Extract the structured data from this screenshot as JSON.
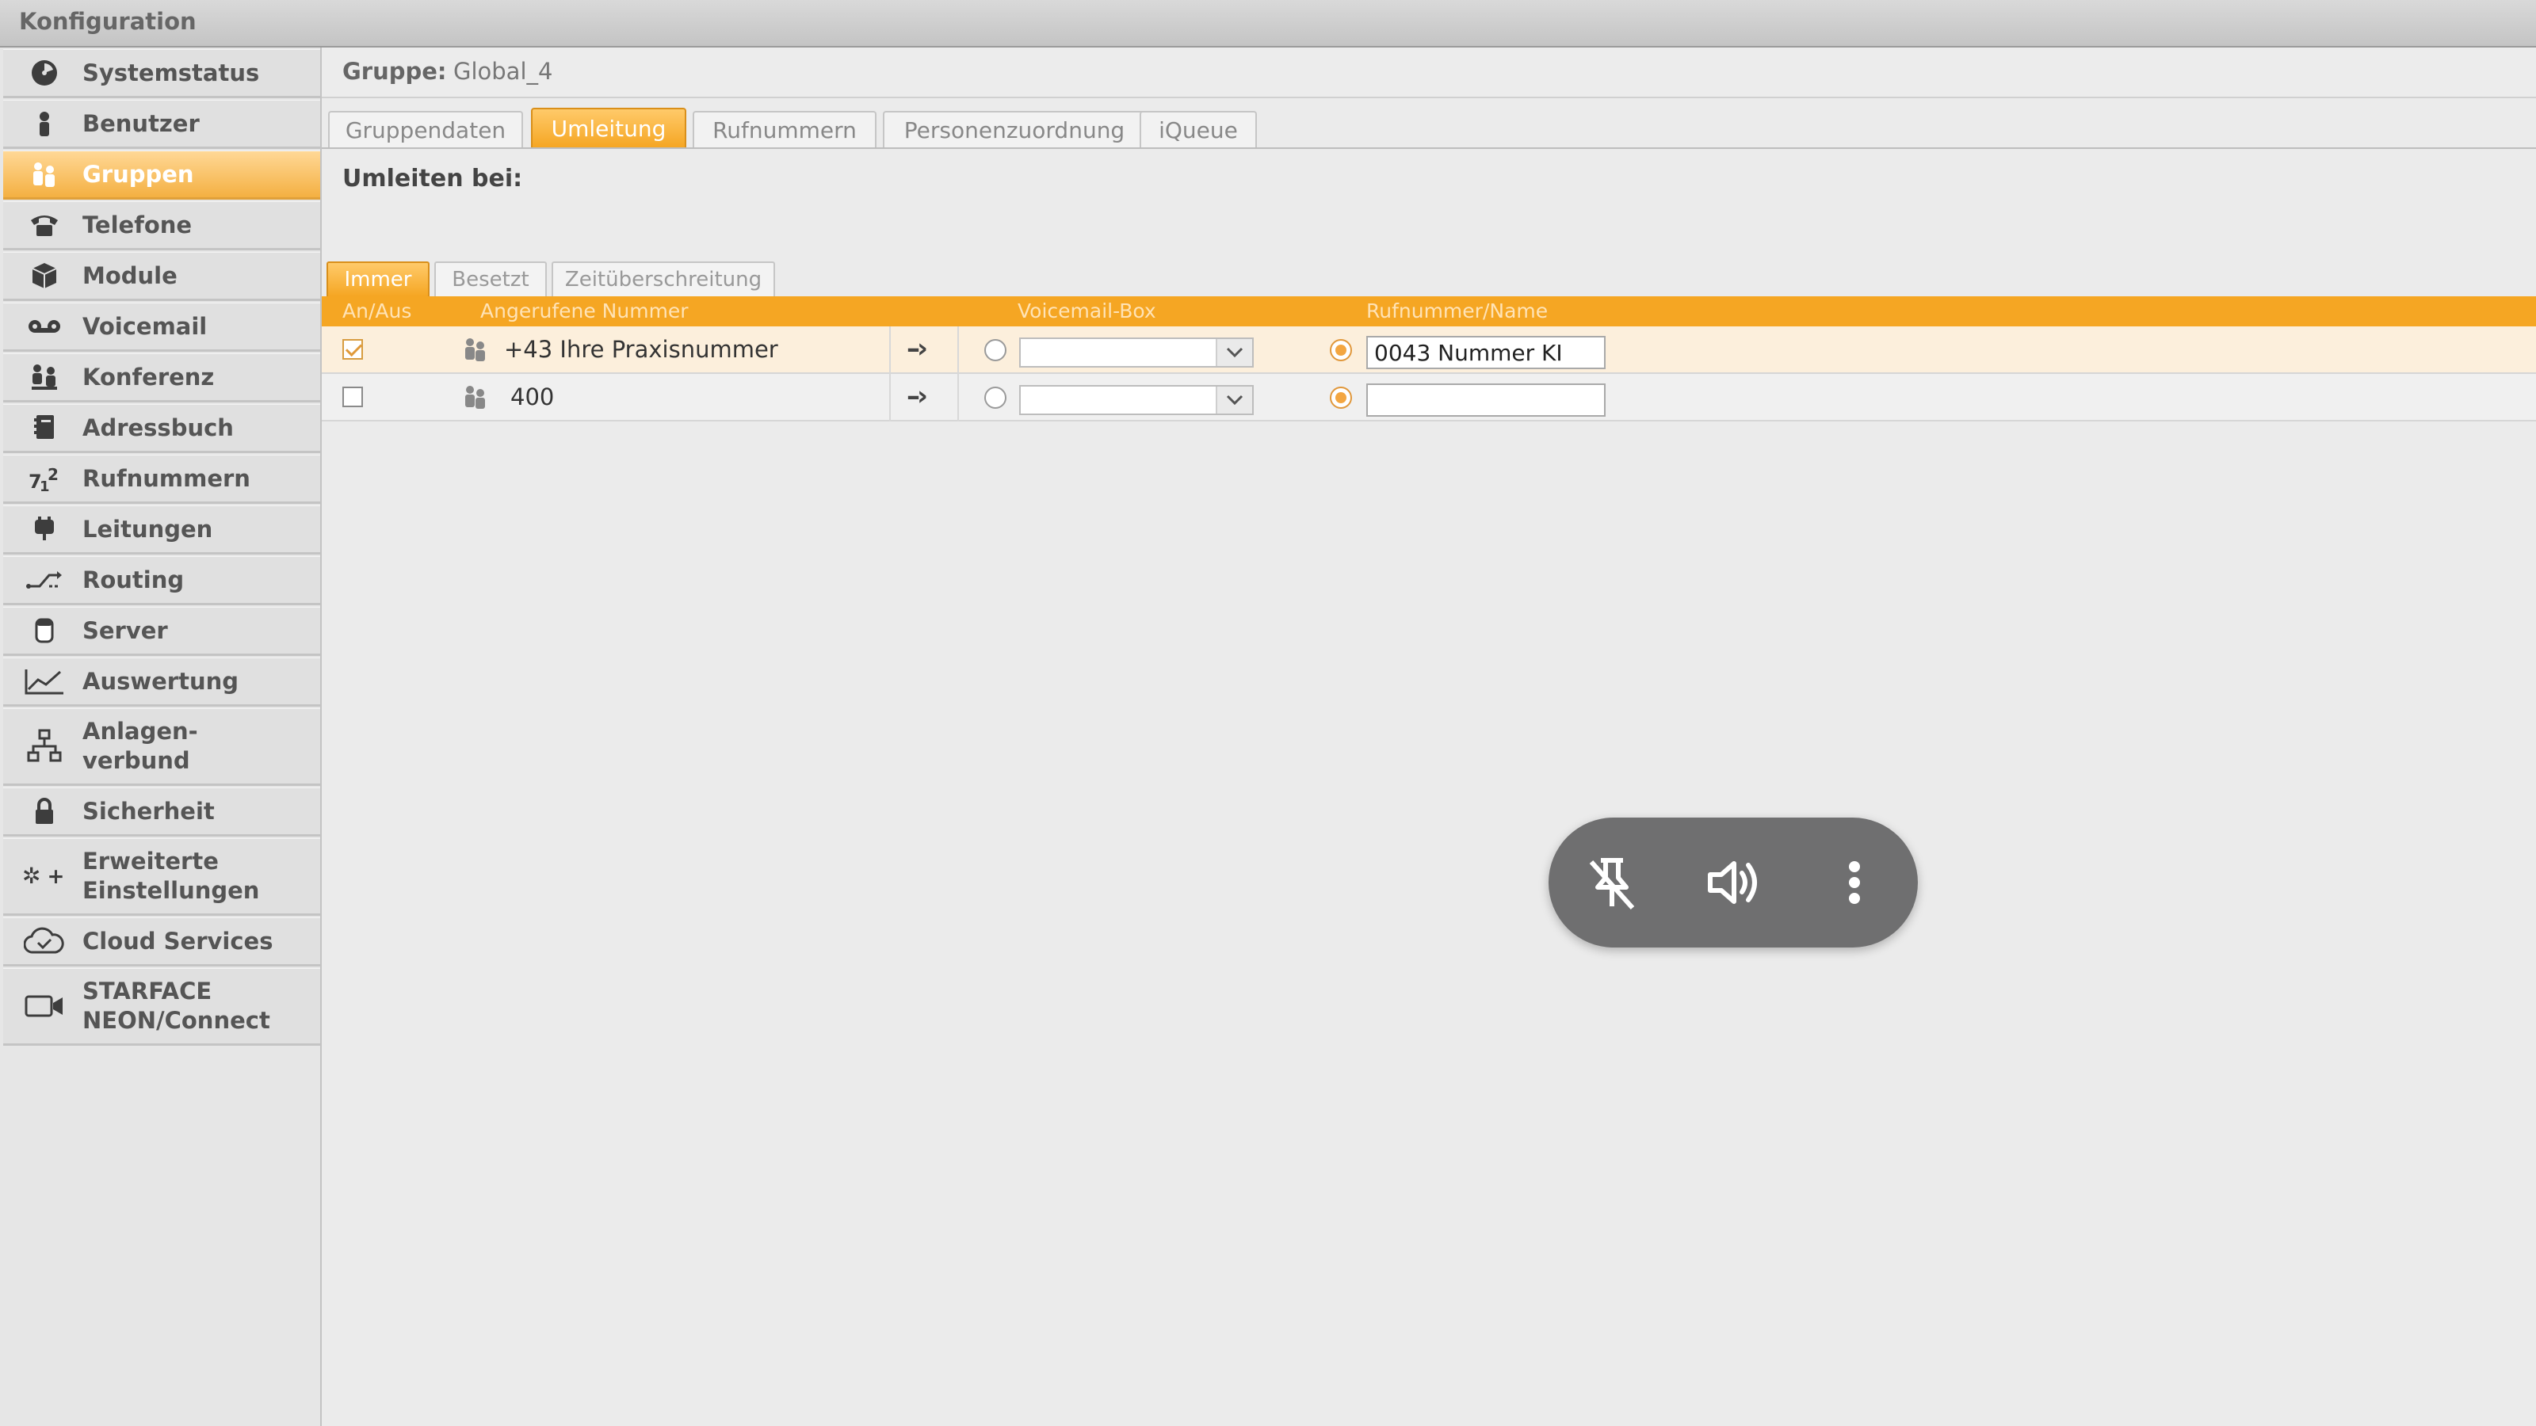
{
  "window": {
    "title": "Konfiguration"
  },
  "sidebar": {
    "items": [
      {
        "label": "Systemstatus",
        "icon": "dashboard-icon"
      },
      {
        "label": "Benutzer",
        "icon": "user-icon"
      },
      {
        "label": "Gruppen",
        "icon": "group-icon",
        "active": true
      },
      {
        "label": "Telefone",
        "icon": "phone-icon"
      },
      {
        "label": "Module",
        "icon": "module-cube-icon"
      },
      {
        "label": "Voicemail",
        "icon": "voicemail-icon"
      },
      {
        "label": "Konferenz",
        "icon": "conference-icon"
      },
      {
        "label": "Adressbuch",
        "icon": "address-book-icon"
      },
      {
        "label": "Rufnummern",
        "icon": "numbers-icon"
      },
      {
        "label": "Leitungen",
        "icon": "line-plug-icon"
      },
      {
        "label": "Routing",
        "icon": "routing-icon"
      },
      {
        "label": "Server",
        "icon": "server-icon"
      },
      {
        "label": "Auswertung",
        "icon": "chart-icon"
      },
      {
        "label": "Anlagen-\nverbund",
        "icon": "network-icon"
      },
      {
        "label": "Sicherheit",
        "icon": "lock-icon"
      },
      {
        "label": "Erweiterte\nEinstellungen",
        "icon": "gears-plus-icon"
      },
      {
        "label": "Cloud Services",
        "icon": "cloud-check-icon"
      },
      {
        "label": "STARFACE\nNEON/Connect",
        "icon": "video-camera-icon"
      }
    ]
  },
  "main": {
    "group_key": "Gruppe:",
    "group_value": "Global_4",
    "tabs": [
      "Gruppendaten",
      "Umleitung",
      "Rufnummern",
      "Personenzuordnung",
      "iQueue"
    ],
    "active_tab": "Umleitung",
    "section_label": "Umleiten bei:",
    "subtabs": [
      "Immer",
      "Besetzt",
      "Zeitüberschreitung"
    ],
    "active_subtab": "Immer",
    "columns": [
      "An/Aus",
      "Angerufene Nummer",
      "Voicemail-Box",
      "Rufnummer/Name"
    ],
    "rows": [
      {
        "enabled": true,
        "number": "+43 Ihre Praxisnummer",
        "arrow": "–›",
        "voicemail_selected": false,
        "voicemail_value": "",
        "target_selected": true,
        "target_value": "0043 Nummer KI"
      },
      {
        "enabled": false,
        "number": "400",
        "arrow": "–›",
        "voicemail_selected": false,
        "voicemail_value": "",
        "target_selected": true,
        "target_value": ""
      }
    ]
  },
  "media_overlay": {
    "buttons": [
      "unpin-icon",
      "volume-icon",
      "more-vertical-icon"
    ]
  },
  "colors": {
    "accent": "#f5a623",
    "sidebar_bg": "#e0e0e0",
    "overlay_bg": "#6f6f70"
  }
}
